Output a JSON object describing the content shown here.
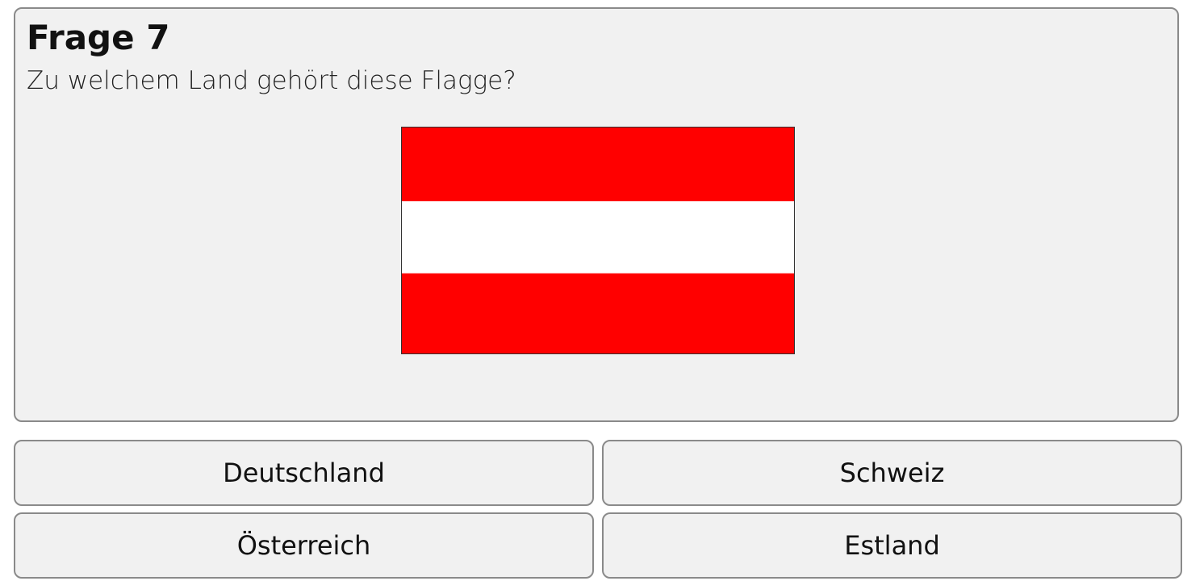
{
  "question": {
    "title": "Frage 7",
    "text": "Zu welchem Land gehört diese Flagge?"
  },
  "flag": {
    "stripes": [
      "#ff0000",
      "#ffffff",
      "#ff0000"
    ]
  },
  "answers": [
    {
      "label": "Deutschland"
    },
    {
      "label": "Schweiz"
    },
    {
      "label": "Österreich"
    },
    {
      "label": "Estland"
    }
  ]
}
